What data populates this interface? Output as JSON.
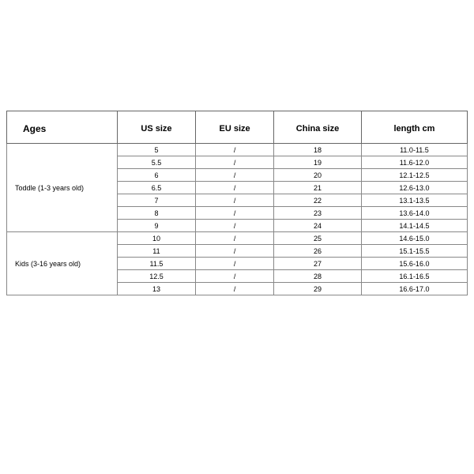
{
  "chart_data": {
    "type": "table",
    "headers": {
      "ages": "Ages",
      "us": "US size",
      "eu": "EU size",
      "china": "China size",
      "length": "length   cm"
    },
    "groups": [
      {
        "label": "Toddle (1-3 years old)",
        "rows": [
          {
            "us": "5",
            "eu": "/",
            "china": "18",
            "length": "11.0-11.5"
          },
          {
            "us": "5.5",
            "eu": "/",
            "china": "19",
            "length": "11.6-12.0"
          },
          {
            "us": "6",
            "eu": "/",
            "china": "20",
            "length": "12.1-12.5"
          },
          {
            "us": "6.5",
            "eu": "/",
            "china": "21",
            "length": "12.6-13.0"
          },
          {
            "us": "7",
            "eu": "/",
            "china": "22",
            "length": "13.1-13.5"
          },
          {
            "us": "8",
            "eu": "/",
            "china": "23",
            "length": "13.6-14.0"
          },
          {
            "us": "9",
            "eu": "/",
            "china": "24",
            "length": "14.1-14.5"
          }
        ]
      },
      {
        "label": "Kids (3-16 years old)",
        "rows": [
          {
            "us": "10",
            "eu": "/",
            "china": "25",
            "length": "14.6-15.0"
          },
          {
            "us": "11",
            "eu": "/",
            "china": "26",
            "length": "15.1-15.5"
          },
          {
            "us": "11.5",
            "eu": "/",
            "china": "27",
            "length": "15.6-16.0"
          },
          {
            "us": "12.5",
            "eu": "/",
            "china": "28",
            "length": "16.1-16.5"
          },
          {
            "us": "13",
            "eu": "/",
            "china": "29",
            "length": "16.6-17.0"
          }
        ]
      }
    ]
  }
}
